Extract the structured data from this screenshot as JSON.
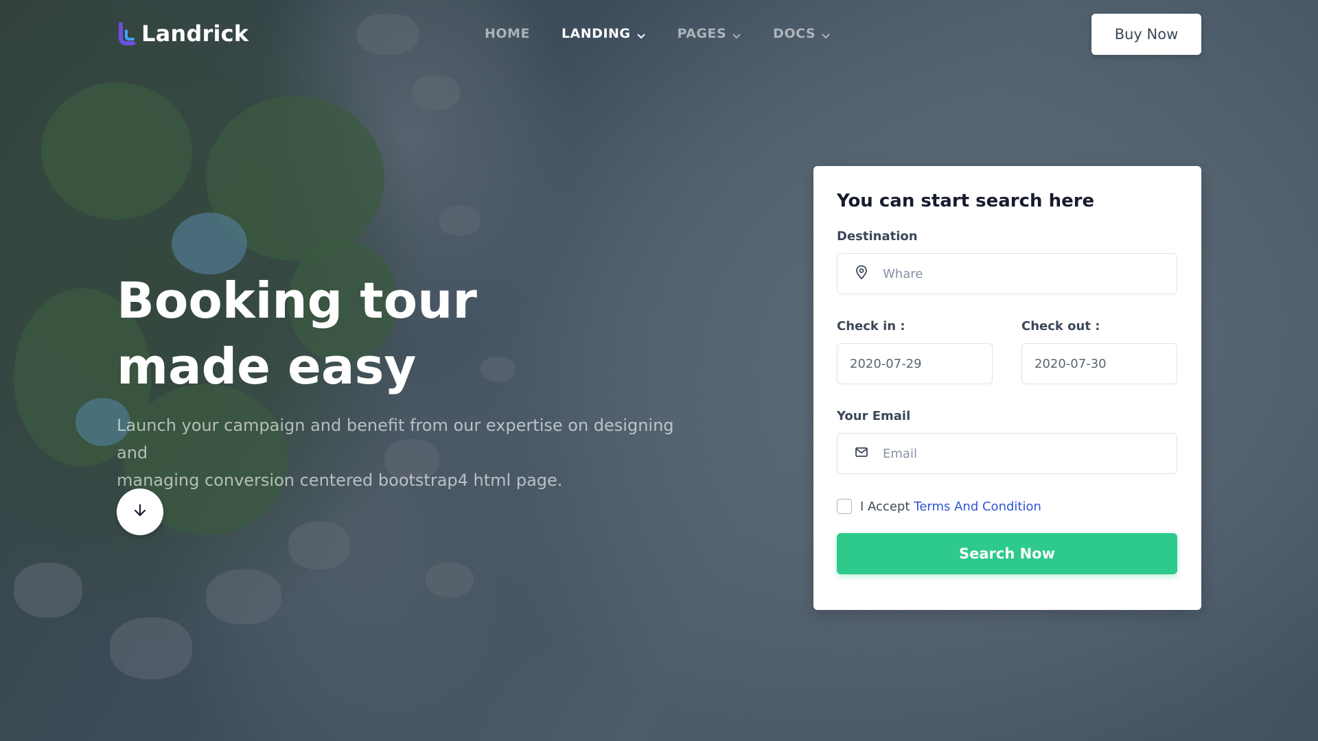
{
  "brand": {
    "name": "Landrick",
    "accent": "#2f55d4",
    "success": "#2eca8b"
  },
  "nav": {
    "items": [
      {
        "label": "HOME",
        "dropdown": false
      },
      {
        "label": "LANDING",
        "dropdown": true
      },
      {
        "label": "PAGES",
        "dropdown": true
      },
      {
        "label": "DOCS",
        "dropdown": true
      }
    ],
    "buy_label": "Buy Now"
  },
  "hero": {
    "title_line1": "Booking tour",
    "title_line2": "made easy",
    "subtitle_line1": "Launch your campaign and benefit from our expertise on designing and",
    "subtitle_line2": "managing conversion centered bootstrap4 html page.",
    "scroll_icon": "arrow-down-icon"
  },
  "search_form": {
    "title": "You can start search here",
    "destination": {
      "label": "Destination",
      "placeholder": "Whare",
      "icon": "map-pin-icon"
    },
    "check_in": {
      "label": "Check in :",
      "value": "2020-07-29"
    },
    "check_out": {
      "label": "Check out :",
      "value": "2020-07-30"
    },
    "email": {
      "label": "Your Email",
      "placeholder": "Email",
      "icon": "mail-icon"
    },
    "accept_text": "I Accept",
    "terms_link": "Terms And Condition",
    "submit_label": "Search Now"
  }
}
